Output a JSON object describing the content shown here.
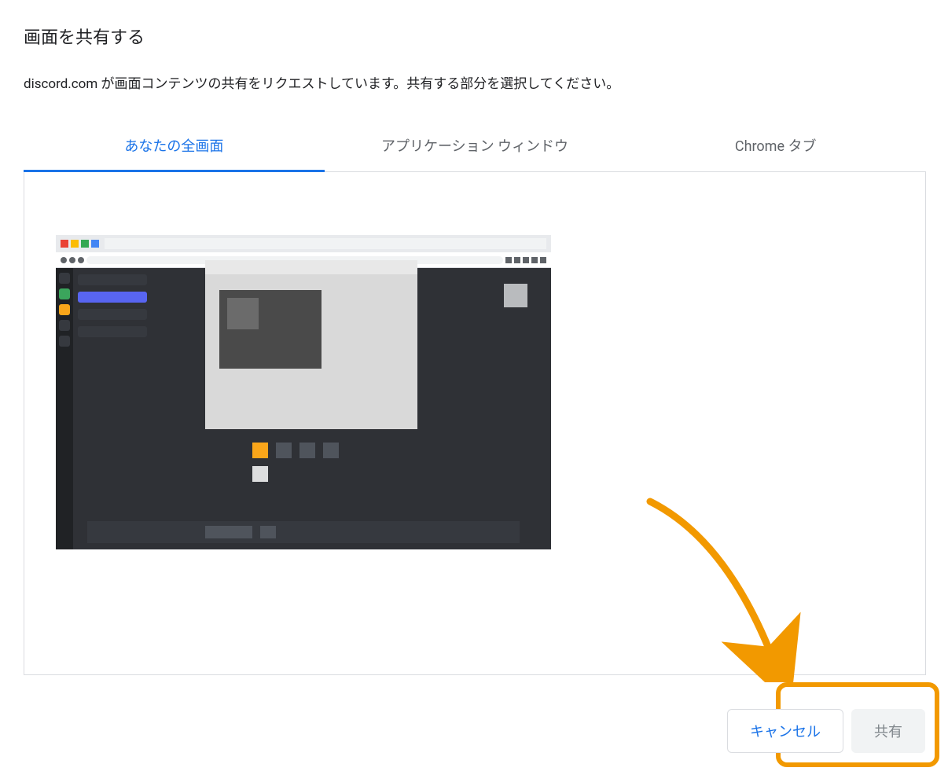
{
  "dialog": {
    "title": "画面を共有する",
    "subtitle": "discord.com が画面コンテンツの共有をリクエストしています。共有する部分を選択してください。"
  },
  "tabs": {
    "entire_screen": "あなたの全画面",
    "app_window": "アプリケーション ウィンドウ",
    "chrome_tab": "Chrome タブ",
    "active": "entire_screen"
  },
  "thumbnail": {
    "name": "screen-thumbnail"
  },
  "buttons": {
    "cancel": "キャンセル",
    "share": "共有"
  },
  "annotation": {
    "highlight_target": "share-button",
    "arrow_color": "#f29900"
  }
}
